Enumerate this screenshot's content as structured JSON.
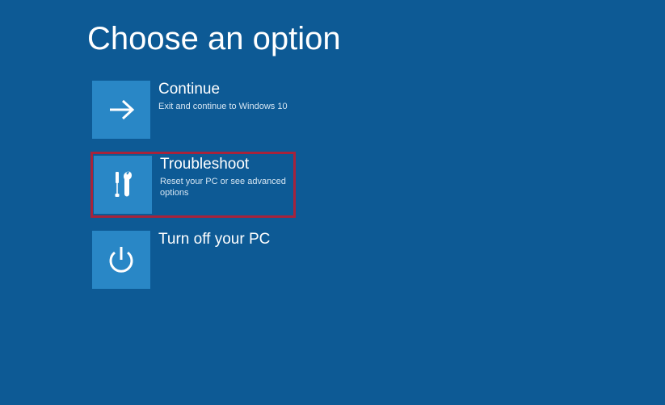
{
  "header": {
    "title": "Choose an option"
  },
  "options": [
    {
      "id": "continue",
      "title": "Continue",
      "description": "Exit and continue to Windows 10",
      "icon": "arrow-right-icon",
      "highlighted": false
    },
    {
      "id": "troubleshoot",
      "title": "Troubleshoot",
      "description": "Reset your PC or see advanced options",
      "icon": "tools-icon",
      "highlighted": true
    },
    {
      "id": "turnoff",
      "title": "Turn off your PC",
      "description": "",
      "icon": "power-icon",
      "highlighted": false
    }
  ],
  "colors": {
    "background": "#0d5a95",
    "tile": "#2987c6",
    "highlight_border": "#a7233b"
  }
}
